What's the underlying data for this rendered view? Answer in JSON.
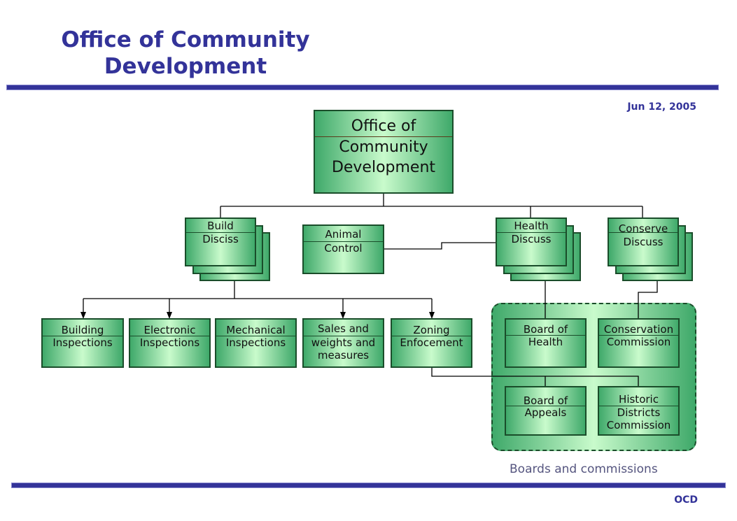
{
  "header": {
    "title_line1": "Office of Community",
    "title_line2": "Development",
    "date": "Jun 12, 2005"
  },
  "footer": {
    "label": "OCD"
  },
  "colors": {
    "brand": "#333399",
    "box_dark": "#3fa96a",
    "box_light": "#c9fbcc",
    "box_border": "#1a4d2a"
  },
  "org": {
    "root": {
      "header": "Office of",
      "body_line1": "Community",
      "body_line2": "Development"
    },
    "build_discuss": {
      "header": "Build",
      "body": "Disciss"
    },
    "animal_control": {
      "header": "Animal",
      "body": "Control"
    },
    "health_discuss": {
      "header": "Health",
      "body": "Discuss"
    },
    "conserve_discuss": {
      "header": "Conserve",
      "body": "Discuss"
    },
    "building_inspections": {
      "header": "Building",
      "body": "Inspections"
    },
    "electronic_inspections": {
      "header": "Electronic",
      "body": "Inspections"
    },
    "mechanical_inspections": {
      "header": "Mechanical",
      "body": "Inspections"
    },
    "sales_weights": {
      "header": "Sales and",
      "body_line1": "weights and",
      "body_line2": "measures"
    },
    "zoning_enforcement": {
      "header": "Zoning",
      "body": "Enfocement"
    },
    "board_of_health": {
      "header": "Board of",
      "body": "Health"
    },
    "conservation_commission": {
      "header": "Conservation",
      "body": "Commission"
    },
    "board_of_appeals": {
      "header": "Board of",
      "body": "Appeals"
    },
    "historic_districts": {
      "header": "Historic",
      "body_line1": "Districts",
      "body_line2": "Commission"
    },
    "group_label": "Boards and commissions"
  }
}
